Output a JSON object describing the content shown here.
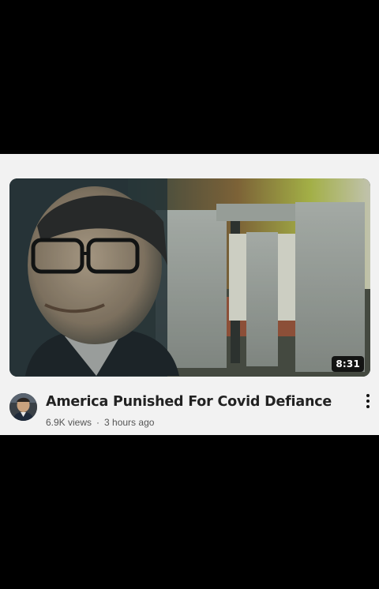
{
  "video": {
    "title": "America Punished For Covid Defiance",
    "views": "6.9K views",
    "separator": "·",
    "age": "3 hours ago",
    "duration": "8:31"
  },
  "icons": {
    "more": "more-vert-icon"
  }
}
